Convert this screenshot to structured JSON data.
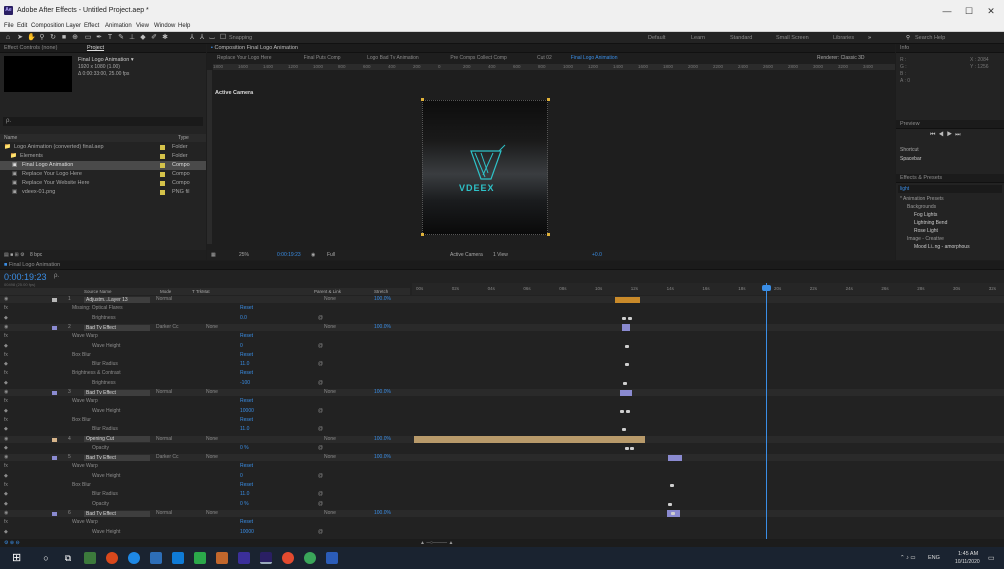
{
  "window": {
    "title": "Adobe After Effects - Untitled Project.aep *",
    "app_icon": "Ae",
    "minimize": "—",
    "maximize": "☐",
    "close": "✕"
  },
  "menu": [
    "File",
    "Edit",
    "Composition",
    "Layer",
    "Effect",
    "Animation",
    "View",
    "Window",
    "Help"
  ],
  "toolbar": {
    "snapping": "Snapping",
    "workspaces": [
      "Default",
      "Learn",
      "Standard",
      "Small Screen",
      "Libraries"
    ],
    "search_placeholder": "Search Help"
  },
  "project": {
    "tab_effect": "Effect Controls (none)",
    "tab_project": "Project",
    "comp_name": "Final Logo Animation ▾",
    "comp_size": "1920 x 1080 (1.00)",
    "comp_dur": "Δ 0:00:33:00, 25.00 fps",
    "search_placeholder": "ρ.",
    "col_name": "Name",
    "col_type": "Type",
    "items": [
      {
        "name": "Logo Animation (converted) final.aep",
        "type": "Folder",
        "color": "#d4c24a"
      },
      {
        "name": "Elements",
        "type": "Folder",
        "color": "#d4c24a"
      },
      {
        "name": "Final Logo Animation",
        "type": "Compo",
        "color": "#d4c24a"
      },
      {
        "name": "Replace Your Logo Here",
        "type": "Compo",
        "color": "#d4c24a"
      },
      {
        "name": "Replace Your Website Here",
        "type": "Compo",
        "color": "#d4c24a"
      },
      {
        "name": "vdeex-01.png",
        "type": "PNG fil",
        "color": "#d4c24a"
      }
    ],
    "bpc": "8 bpc"
  },
  "composition": {
    "tab": "Composition Final Logo Animation",
    "breadcrumbs": [
      "Replace Your Logo Here",
      "Final Puts Comp",
      "Logo Bad Tv Animation",
      "Pre Comps Collect Comp",
      "Cut 02",
      "Final Logo Animation"
    ],
    "renderer": "Renderer:",
    "renderer_val": "Classic 3D",
    "ruler": [
      "1800",
      "1600",
      "1400",
      "1200",
      "1000",
      "800",
      "600",
      "400",
      "200",
      "0",
      "200",
      "400",
      "600",
      "800",
      "1000",
      "1200",
      "1400",
      "1600",
      "1800",
      "2000",
      "2200",
      "2400",
      "2600",
      "2800",
      "3000",
      "3200",
      "3400"
    ],
    "active_camera": "Active Camera",
    "logo_text": "VDEEX",
    "zoom": "25%",
    "timecode": "0:00:19:23",
    "quality": "Full",
    "camera": "Active Camera",
    "views": "1 View",
    "exposure": "+0.0"
  },
  "right": {
    "info": "Info",
    "r": "R :",
    "g": "G :",
    "b": "B :",
    "a": "A : 0",
    "x": "X : 2084",
    "y": "Y : 1256",
    "preview": "Preview",
    "shortcut": "Shortcut",
    "shortcut_val": "Spacebar",
    "ep": "Effects & Presets",
    "ep_search": "light",
    "tree": [
      {
        "label": "* Animation Presets",
        "indent": 0
      },
      {
        "label": "Backgrounds",
        "indent": 1
      },
      {
        "label": "Fog Lights",
        "indent": 2
      },
      {
        "label": "Lightning Bend",
        "indent": 2
      },
      {
        "label": "Rose Light",
        "indent": 2
      },
      {
        "label": "Image - Creative",
        "indent": 1
      },
      {
        "label": "Mood Li..ng - amorphous",
        "indent": 2
      }
    ]
  },
  "timeline": {
    "tab": "Final Logo Animation",
    "timecode": "0:00:19:23",
    "frames": "00498 (25.00 fps)",
    "search": "ρ.",
    "cols": {
      "source": "Source Name",
      "mode": "Mode",
      "trkmat": "T  TrkMat",
      "parent": "Parent & Link",
      "stretch": "Stretch"
    },
    "ruler": [
      "00s",
      "02s",
      "04s",
      "06s",
      "08s",
      "10s",
      "12s",
      "14s",
      "16s",
      "18s",
      "20s",
      "22s",
      "24s",
      "26s",
      "28s",
      "30s",
      "32s"
    ],
    "rows": [
      {
        "kind": "layer",
        "num": "1",
        "name": "Adjustm...Layer 13",
        "mode": "Normal",
        "trk": "",
        "parent": "None",
        "stretch": "100.0%",
        "color": "#b8b8b8"
      },
      {
        "kind": "group",
        "label": "Missing: Optical Flares",
        "reset": "Reset"
      },
      {
        "kind": "prop",
        "label": "Brightness",
        "value": "0.0"
      },
      {
        "kind": "layer",
        "num": "2",
        "name": "Bad Tv Effect",
        "mode": "Darker Cc",
        "trk": "None",
        "parent": "None",
        "stretch": "100.0%",
        "color": "#8a8ad0"
      },
      {
        "kind": "group",
        "label": "Wave Warp",
        "reset": "Reset"
      },
      {
        "kind": "prop",
        "label": "Wave Height",
        "value": "0"
      },
      {
        "kind": "group",
        "label": "Box Blur",
        "reset": "Reset"
      },
      {
        "kind": "prop",
        "label": "Blur Radius",
        "value": "11.0"
      },
      {
        "kind": "group",
        "label": "Brightness & Contrast",
        "reset": "Reset"
      },
      {
        "kind": "prop",
        "label": "Brightness",
        "value": "-100"
      },
      {
        "kind": "layer",
        "num": "3",
        "name": "Bad Tv Effect",
        "mode": "Normal",
        "trk": "None",
        "parent": "None",
        "stretch": "100.0%",
        "color": "#8a8ad0"
      },
      {
        "kind": "group",
        "label": "Wave Warp",
        "reset": "Reset"
      },
      {
        "kind": "prop",
        "label": "Wave Height",
        "value": "10000"
      },
      {
        "kind": "group",
        "label": "Box Blur",
        "reset": "Reset"
      },
      {
        "kind": "prop",
        "label": "Blur Radius",
        "value": "11.0"
      },
      {
        "kind": "layer",
        "num": "4",
        "name": "Opening Cut",
        "mode": "Normal",
        "trk": "None",
        "parent": "None",
        "stretch": "100.0%",
        "color": "#d6b48a"
      },
      {
        "kind": "prop",
        "label": "Opacity",
        "value": "0 %"
      },
      {
        "kind": "layer",
        "num": "5",
        "name": "Bad Tv Effect",
        "mode": "Darker Cc",
        "trk": "None",
        "parent": "None",
        "stretch": "100.0%",
        "color": "#8a8ad0"
      },
      {
        "kind": "group",
        "label": "Wave Warp",
        "reset": "Reset"
      },
      {
        "kind": "prop",
        "label": "Wave Height",
        "value": "0"
      },
      {
        "kind": "group",
        "label": "Box Blur",
        "reset": "Reset"
      },
      {
        "kind": "prop",
        "label": "Blur Radius",
        "value": "11.0"
      },
      {
        "kind": "prop",
        "label": "Opacity",
        "value": "0 %"
      },
      {
        "kind": "layer",
        "num": "6",
        "name": "Bad Tv Effect",
        "mode": "Normal",
        "trk": "None",
        "parent": "None",
        "stretch": "100.0%",
        "color": "#8a8ad0"
      },
      {
        "kind": "group",
        "label": "Wave Warp",
        "reset": "Reset"
      },
      {
        "kind": "prop",
        "label": "Wave Height",
        "value": "10000"
      }
    ],
    "toggle": "Toggle Switches / Modes"
  },
  "taskbar": {
    "time": "1:45 AM",
    "date": "10/11/2020",
    "lang": "ENG"
  }
}
